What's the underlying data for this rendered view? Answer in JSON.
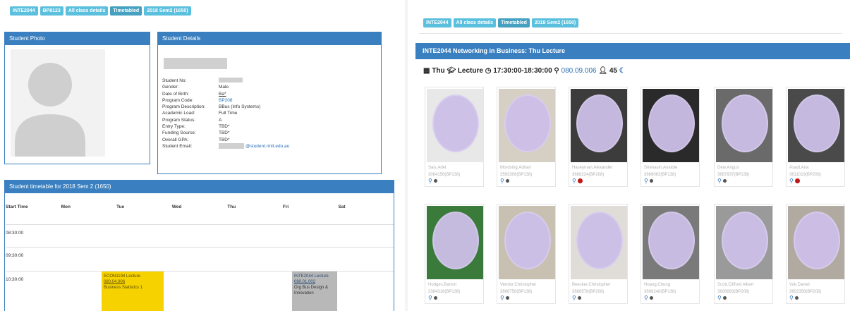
{
  "left": {
    "tags": [
      "INTE2044",
      "BP8123",
      "All class details",
      "Timetabled",
      "2018 Sem2 (1650)"
    ],
    "photo_panel_title": "Student Photo",
    "details_panel_title": "Student Details",
    "details": [
      {
        "k": "Student No:",
        "v": ""
      },
      {
        "k": "Gender:",
        "v": "Male"
      },
      {
        "k": "Date of Birth:",
        "v": "Ba*"
      },
      {
        "k": "Program Code:",
        "v": "BP208"
      },
      {
        "k": "Program Description:",
        "v": "BBus (Info Systems)"
      },
      {
        "k": "Academic Load:",
        "v": "Full Time"
      },
      {
        "k": "Program Status:",
        "v": "A"
      },
      {
        "k": "Entry Type:",
        "v": "TBD*"
      },
      {
        "k": "Funding Source:",
        "v": "TBD*"
      },
      {
        "k": "Overall GPA:",
        "v": "TBD*"
      },
      {
        "k": "Student Email:",
        "v": "@student.rmit.edu.au"
      }
    ],
    "timetable_title": "Student timetable for 2018 Sem 2 (1650)",
    "days": [
      "Start Time",
      "Mon",
      "Tue",
      "Wed",
      "Thu",
      "Fri",
      "Sat"
    ],
    "times": [
      "08:30:00",
      "09:30:00",
      "10:30:00"
    ],
    "blocks": [
      {
        "lines": [
          "ECON1194 Lecture",
          "080.04.006",
          "Business Statistics 1"
        ]
      },
      {
        "lines": [
          "INTE2044 Lecture",
          "080.01.002",
          "Org Bus Design &",
          "Innovation"
        ]
      }
    ]
  },
  "right": {
    "tags": [
      "INTE2044",
      "All class details",
      "Timetabled",
      "2018 Sem2 (1650)"
    ],
    "lecture_title": "INTE2044 Networking in Business: Thu Lecture",
    "info": {
      "day": "Thu",
      "type": "Lecture",
      "time": "17:30:00-18:30:00",
      "room": "080.09.006",
      "count": "45"
    },
    "students": [
      {
        "name": "Sais,Adel",
        "id": "3064156(BP138)",
        "red": false
      },
      {
        "name": "Mordsing,Adrian",
        "id": "3593308(BP138)",
        "red": false
      },
      {
        "name": "Haseyman,Alexander",
        "id": "3668224(BP208)",
        "red": true
      },
      {
        "name": "Strenasin,Anatole",
        "id": "3669063(BP138)",
        "red": false
      },
      {
        "name": "Dew,Angus",
        "id": "3667937(BP138)",
        "red": false
      },
      {
        "name": "Asadi,Aria",
        "id": "3611019(BP208)",
        "red": true
      },
      {
        "name": "Hodges,Barton",
        "id": "3384318(BP138)",
        "red": false
      },
      {
        "name": "Vendor,Christopher",
        "id": "3668758(BP138)",
        "red": false
      },
      {
        "name": "Beecker,Christopher",
        "id": "3668578(BP208)",
        "red": false
      },
      {
        "name": "Hoang,Chung",
        "id": "3669248(BP138)",
        "red": false
      },
      {
        "name": "Scott,Clifford Albert",
        "id": "3606693(BP208)",
        "red": false
      },
      {
        "name": "Vok,Daniel",
        "id": "3602358(BP208)",
        "red": false
      }
    ]
  },
  "colors": {
    "primary": "#3a80c0",
    "tag": "#5bc0de",
    "block_yellow": "#f6d200",
    "block_grey": "#b8b8b8",
    "blur": "#cdbfe8"
  }
}
